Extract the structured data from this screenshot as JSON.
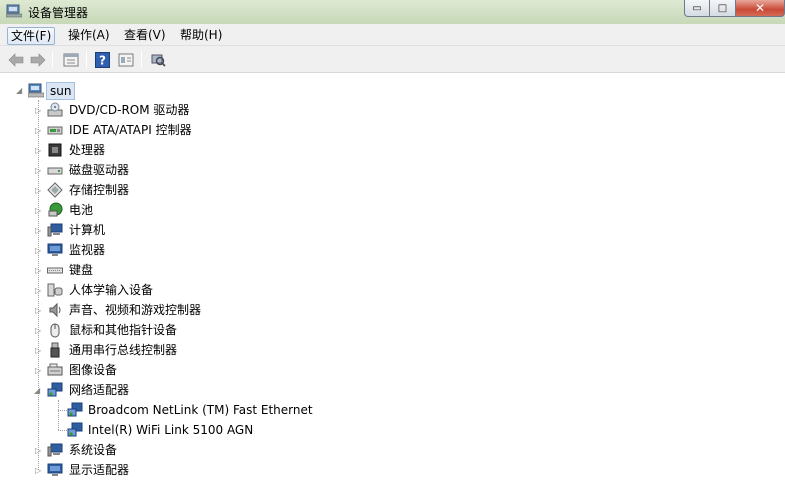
{
  "window": {
    "title": "设备管理器",
    "controls": {
      "minimize": "▭",
      "maximize": "□",
      "close": "✕"
    }
  },
  "menu": [
    "文件(F)",
    "操作(A)",
    "查看(V)",
    "帮助(H)"
  ],
  "toolbar": [
    "back-arrow-icon",
    "forward-arrow-icon",
    "properties-icon",
    "help-icon",
    "view-icon",
    "scan-hardware-icon"
  ],
  "tree": {
    "root": "sun",
    "categories": [
      {
        "label": "DVD/CD-ROM 驱动器",
        "icon": "dvd-drive-icon"
      },
      {
        "label": "IDE ATA/ATAPI 控制器",
        "icon": "ide-controller-icon"
      },
      {
        "label": "处理器",
        "icon": "processor-icon"
      },
      {
        "label": "磁盘驱动器",
        "icon": "disk-drive-icon"
      },
      {
        "label": "存储控制器",
        "icon": "storage-controller-icon"
      },
      {
        "label": "电池",
        "icon": "battery-icon"
      },
      {
        "label": "计算机",
        "icon": "computer-icon"
      },
      {
        "label": "监视器",
        "icon": "monitor-icon"
      },
      {
        "label": "键盘",
        "icon": "keyboard-icon"
      },
      {
        "label": "人体学输入设备",
        "icon": "hid-icon"
      },
      {
        "label": "声音、视频和游戏控制器",
        "icon": "sound-icon"
      },
      {
        "label": "鼠标和其他指针设备",
        "icon": "mouse-icon"
      },
      {
        "label": "通用串行总线控制器",
        "icon": "usb-icon"
      },
      {
        "label": "图像设备",
        "icon": "imaging-icon"
      },
      {
        "label": "网络适配器",
        "icon": "network-adapter-icon",
        "expanded": true,
        "children": [
          "Broadcom NetLink (TM) Fast Ethernet",
          "Intel(R) WiFi Link 5100 AGN"
        ]
      },
      {
        "label": "系统设备",
        "icon": "system-devices-icon"
      },
      {
        "label": "显示适配器",
        "icon": "display-adapter-icon"
      }
    ]
  }
}
